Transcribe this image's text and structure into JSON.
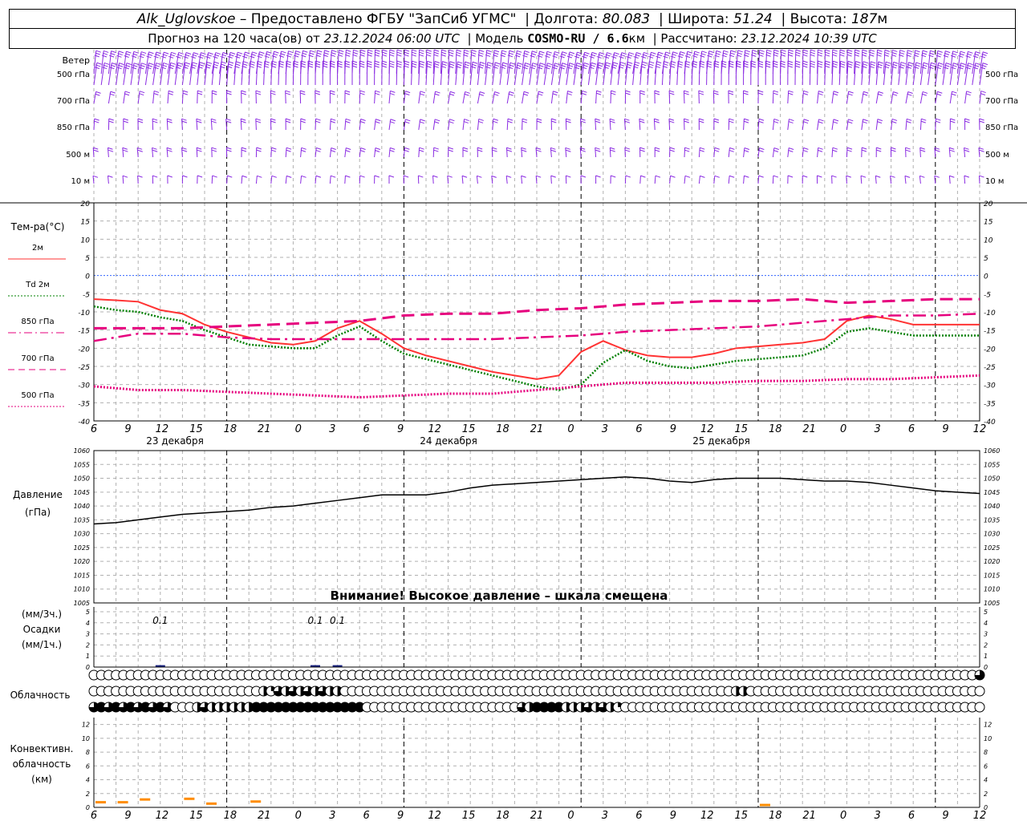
{
  "header": {
    "station": "Alk_Uglovskoe",
    "provider_sep": " – ",
    "provider": "Предоставлено ФГБУ \"ЗапСиб УГМС\"",
    "lon_label": "Долгота:",
    "lon": "80.083",
    "lat_label": "Широта:",
    "lat": "51.24",
    "alt_label": "Высота:",
    "alt": "187",
    "alt_unit": "м",
    "forecast_label": "Прогноз на 120 часа(ов) от",
    "forecast_from": "23.12.2024 06:00 UTC",
    "model_label": "Модель",
    "model": "COSMO-RU / 6.6",
    "model_unit": "км",
    "calc_label": "Рассчитано:",
    "calc_time": "23.12.2024 10:39 UTC"
  },
  "time_axis": {
    "hour_labels": [
      "6",
      "9",
      "12",
      "15",
      "18",
      "21",
      "0",
      "3",
      "6",
      "9",
      "12",
      "15",
      "18",
      "21",
      "0",
      "3",
      "6",
      "9",
      "12",
      "15",
      "18",
      "21",
      "0",
      "3",
      "6",
      "9",
      "12"
    ],
    "dates": [
      "23 декабря",
      "24 декабря",
      "25 декабря"
    ]
  },
  "wind": {
    "title": "Ветер",
    "levels": [
      "500 гПа",
      "700 гПа",
      "850 гПа",
      "500 м",
      "10  м"
    ],
    "color": "#8a2be2"
  },
  "temperature": {
    "title": "Тем-ра(°С)",
    "ticks": [
      "20",
      "15",
      "10",
      "5",
      "0",
      "-5",
      "-10",
      "-15",
      "-20",
      "-25",
      "-30",
      "-35",
      "-40"
    ],
    "legend": [
      {
        "label": "2м",
        "color": "#ff3333",
        "style": "solid"
      },
      {
        "label": "Td  2м",
        "color": "#008000",
        "style": "dotted"
      },
      {
        "label": "850 гПа",
        "color": "#e6007e",
        "style": "dashdot"
      },
      {
        "label": "700 гПа",
        "color": "#e6007e",
        "style": "dashed"
      },
      {
        "label": "500 гПа",
        "color": "#e6007e",
        "style": "dotted"
      }
    ]
  },
  "pressure": {
    "title": "Давление",
    "unit": "(гПа)",
    "ticks": [
      "1060",
      "1055",
      "1050",
      "1045",
      "1040",
      "1035",
      "1030",
      "1025",
      "1020",
      "1015",
      "1010",
      "1005"
    ],
    "warning": "Внимание! Высокое давление – шкала смещена"
  },
  "precip": {
    "title_lines": [
      "(мм/3ч.)",
      "Осадки",
      "(мм/1ч.)"
    ],
    "ticks": [
      "5",
      "4",
      "3",
      "2",
      "1",
      "0"
    ],
    "labels": [
      {
        "hour": 9,
        "text": "0.1"
      },
      {
        "hour": 30,
        "text": "0.1"
      },
      {
        "hour": 33,
        "text": "0.1"
      }
    ]
  },
  "clouds": {
    "title": "Облачность"
  },
  "convective": {
    "title_lines": [
      "Конвективн.",
      "облачность",
      "(км)"
    ],
    "ticks": [
      "12",
      "10",
      "8",
      "6",
      "4",
      "2",
      "0"
    ],
    "color": "#ff8c00"
  },
  "chart_data": [
    {
      "type": "line",
      "title": "Тем-ра(°С)",
      "x_unit": "hours since 23.12.2024 06:00 UTC",
      "ylim": [
        -40,
        20
      ],
      "series": [
        {
          "name": "2м",
          "x": [
            0,
            3,
            6,
            9,
            12,
            15,
            18,
            21,
            24,
            27,
            30,
            33,
            36,
            39,
            42,
            45,
            48,
            51,
            54,
            57,
            60,
            63,
            66,
            69,
            72,
            75,
            78,
            81,
            84,
            87,
            90,
            93,
            96,
            99,
            102,
            105,
            108,
            111,
            114,
            117,
            120
          ],
          "values": [
            -6.5,
            -6.8,
            -7.2,
            -9.5,
            -10.5,
            -13.5,
            -15.5,
            -17,
            -18.5,
            -19,
            -18,
            -14.5,
            -12.5,
            -16,
            -20,
            -22,
            -23.5,
            -25,
            -26.5,
            -27.5,
            -28.5,
            -27.5,
            -21,
            -18,
            -20.5,
            -22,
            -22.5,
            -22.5,
            -21.5,
            -20,
            -19.5,
            -19,
            -18.5,
            -17.5,
            -12.5,
            -11,
            -12,
            -13.5,
            -13.5,
            -13.5,
            -13.5
          ]
        },
        {
          "name": "Td  2м",
          "x": [
            0,
            3,
            6,
            9,
            12,
            15,
            18,
            21,
            24,
            27,
            30,
            33,
            36,
            39,
            42,
            45,
            48,
            51,
            54,
            57,
            60,
            63,
            66,
            69,
            72,
            75,
            78,
            81,
            84,
            87,
            90,
            93,
            96,
            99,
            102,
            105,
            108,
            111,
            114,
            117,
            120
          ],
          "values": [
            -8.5,
            -9.5,
            -10,
            -11.5,
            -12.5,
            -15,
            -17,
            -19,
            -19.5,
            -20,
            -20,
            -16.5,
            -14,
            -18,
            -21.5,
            -23,
            -24.5,
            -26,
            -27.5,
            -29,
            -30.5,
            -31.5,
            -30,
            -24,
            -20.5,
            -23.5,
            -25,
            -25.5,
            -24.5,
            -23.5,
            -23,
            -22.5,
            -22,
            -20,
            -15.5,
            -14.5,
            -15.5,
            -16.5,
            -16.5,
            -16.5,
            -16.5
          ]
        },
        {
          "name": "850 гПа",
          "x": [
            0,
            6,
            12,
            18,
            24,
            30,
            36,
            42,
            48,
            54,
            60,
            66,
            72,
            78,
            84,
            90,
            96,
            102,
            108,
            114,
            120
          ],
          "values": [
            -18,
            -16,
            -16,
            -17,
            -17.5,
            -17.5,
            -17.5,
            -17.5,
            -17.5,
            -17.5,
            -17,
            -16.5,
            -15.5,
            -15,
            -14.5,
            -14,
            -13,
            -12,
            -11,
            -11,
            -10.5
          ]
        },
        {
          "name": "700 гПа",
          "x": [
            0,
            6,
            12,
            18,
            24,
            30,
            36,
            42,
            48,
            54,
            60,
            66,
            72,
            78,
            84,
            90,
            96,
            102,
            108,
            114,
            120
          ],
          "values": [
            -14.5,
            -14.5,
            -14.5,
            -14,
            -13.5,
            -13,
            -12.5,
            -11,
            -10.5,
            -10.5,
            -9.5,
            -9,
            -8,
            -7.5,
            -7,
            -7,
            -6.5,
            -7.5,
            -7,
            -6.5,
            -6.5
          ]
        },
        {
          "name": "500 гПа",
          "x": [
            0,
            6,
            12,
            18,
            24,
            30,
            36,
            42,
            48,
            54,
            60,
            66,
            72,
            78,
            84,
            90,
            96,
            102,
            108,
            114,
            120
          ],
          "values": [
            -30.5,
            -31.5,
            -31.5,
            -32,
            -32.5,
            -33,
            -33.5,
            -33,
            -32.5,
            -32.5,
            -31.5,
            -30.5,
            -29.5,
            -29.5,
            -29.5,
            -29,
            -29,
            -28.5,
            -28.5,
            -28,
            -27.5
          ]
        }
      ]
    },
    {
      "type": "line",
      "title": "Давление (гПа)",
      "x_unit": "hours since 23.12.2024 06:00 UTC",
      "ylim": [
        1005,
        1060
      ],
      "series": [
        {
          "name": "Давление",
          "x": [
            0,
            3,
            6,
            9,
            12,
            15,
            18,
            21,
            24,
            27,
            30,
            33,
            36,
            39,
            42,
            45,
            48,
            51,
            54,
            57,
            60,
            63,
            66,
            69,
            72,
            75,
            78,
            81,
            84,
            87,
            90,
            93,
            96,
            99,
            102,
            105,
            108,
            111,
            114,
            117,
            120
          ],
          "values": [
            1033.5,
            1034,
            1035,
            1036,
            1037,
            1037.5,
            1038,
            1038.5,
            1039.5,
            1040,
            1041,
            1042,
            1043,
            1044,
            1044,
            1044,
            1045,
            1046.5,
            1047.5,
            1048,
            1048.5,
            1049,
            1049.5,
            1050,
            1050.5,
            1050,
            1049,
            1048.5,
            1049.5,
            1050,
            1050,
            1050,
            1049.5,
            1049,
            1049,
            1048.5,
            1047.5,
            1046.5,
            1045.5,
            1045,
            1044.5
          ]
        }
      ]
    },
    {
      "type": "bar",
      "title": "Осадки",
      "ylim": [
        0,
        5
      ],
      "x": [
        9,
        30,
        33
      ],
      "values": [
        0.1,
        0.1,
        0.1
      ]
    },
    {
      "type": "bar",
      "title": "Конвективн. облачность (км)",
      "ylim": [
        0,
        13
      ],
      "x": [
        0,
        3,
        6,
        9,
        12,
        15,
        18,
        21,
        90
      ],
      "values": [
        0.8,
        0.8,
        1.2,
        0,
        1.3,
        0.6,
        0,
        0.9,
        0.4
      ]
    }
  ]
}
